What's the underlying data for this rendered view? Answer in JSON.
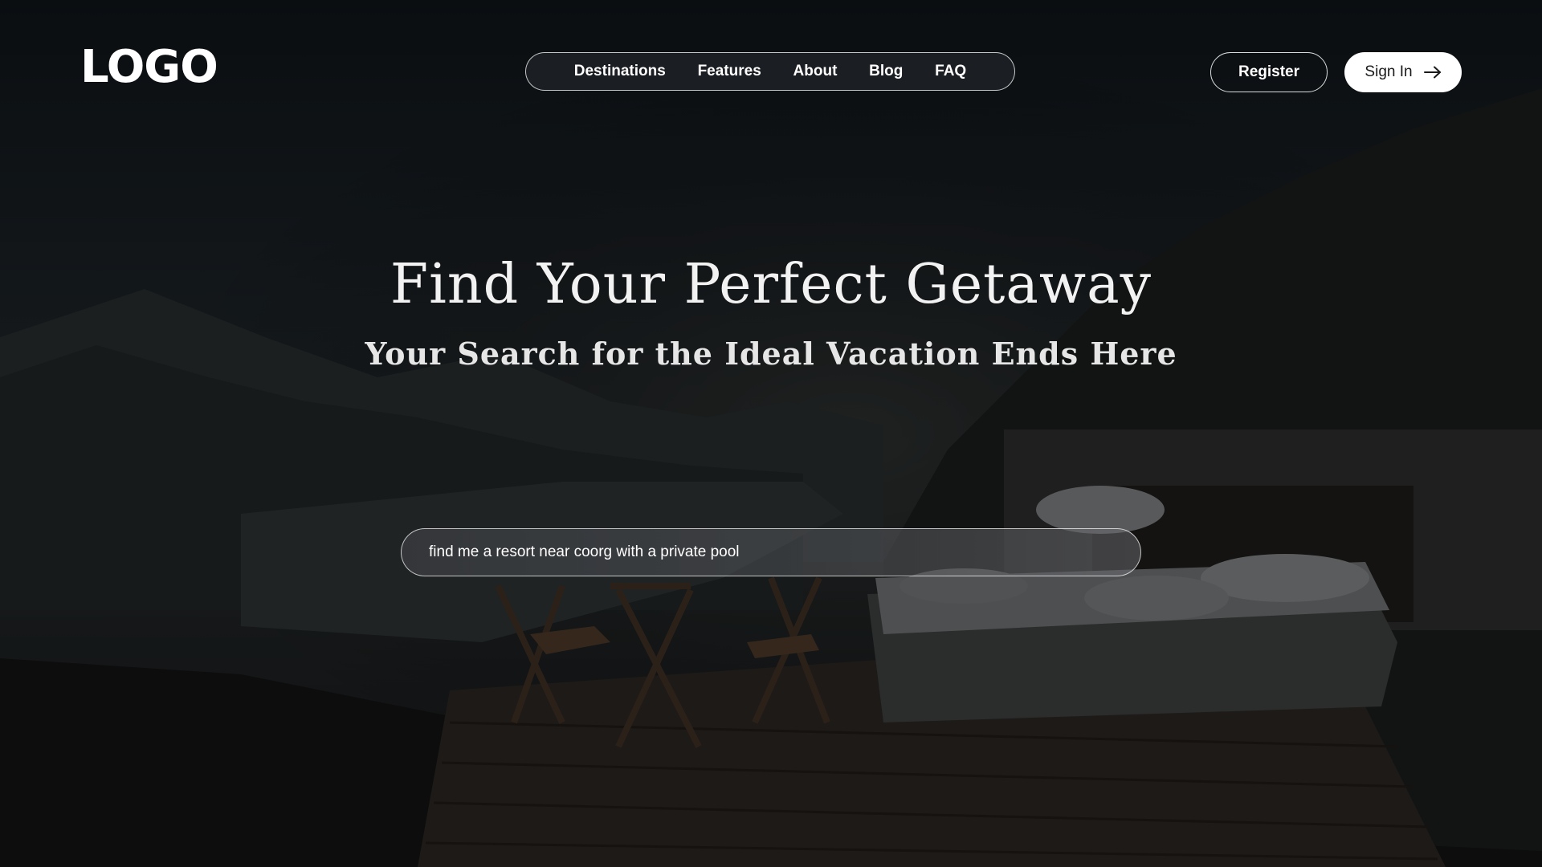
{
  "header": {
    "logo_text": "LOGO",
    "nav_items": [
      {
        "label": "Destinations"
      },
      {
        "label": "Features"
      },
      {
        "label": "About"
      },
      {
        "label": "Blog"
      },
      {
        "label": "FAQ"
      }
    ],
    "register_label": "Register",
    "signin_label": "Sign In",
    "signin_icon": "arrow-right-icon"
  },
  "hero": {
    "title": "Find Your Perfect Getaway",
    "subtitle": "Your Search for the Ideal Vacation Ends Here",
    "background": "mountain-lake-outdoor-bed-scene"
  },
  "search": {
    "value": "find me a resort near coorg with a private pool",
    "placeholder": ""
  },
  "colors": {
    "background": "#0d1115",
    "text": "#ffffff",
    "signin_bg": "#ffffff",
    "signin_text": "#1a1a1a"
  }
}
